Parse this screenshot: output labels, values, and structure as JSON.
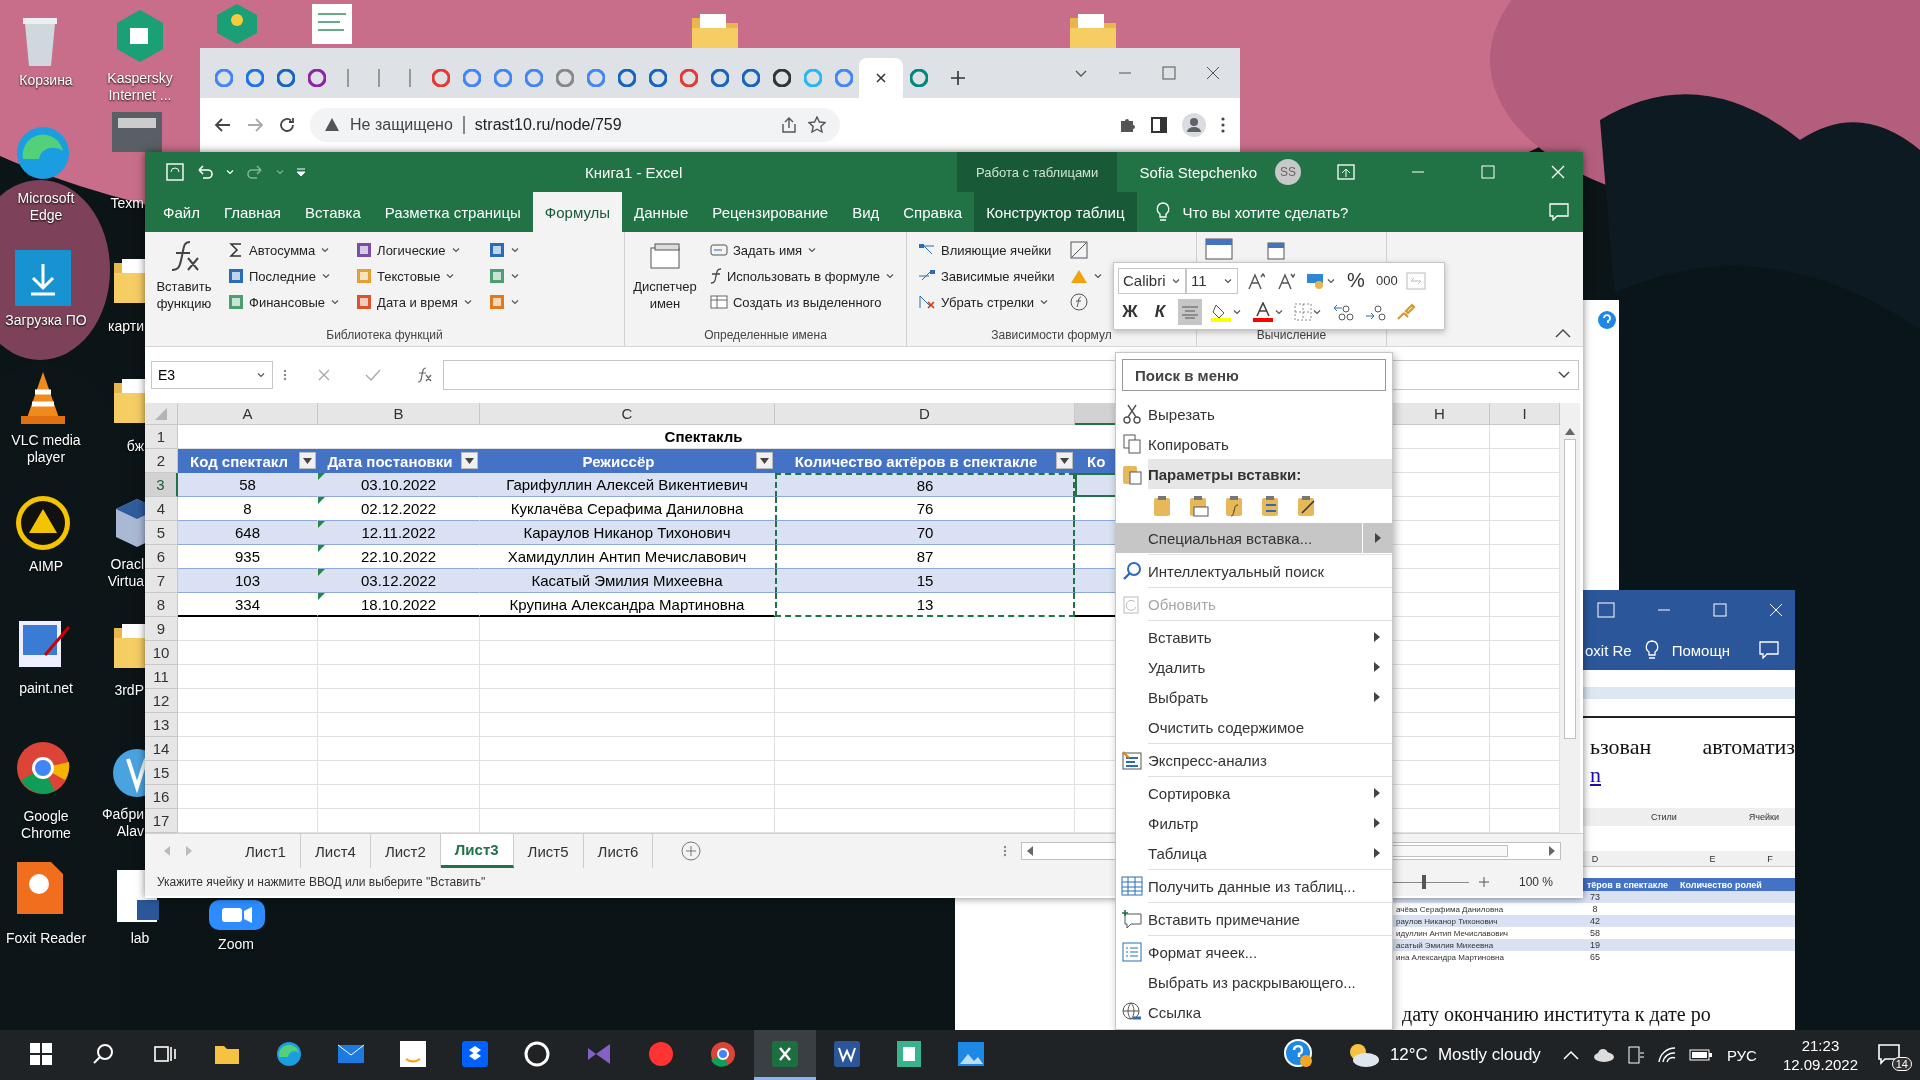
{
  "desktop_icons": [
    {
      "label": "Корзина"
    },
    {
      "label": "Microsoft Edge"
    },
    {
      "label": "Загрузка ПО"
    },
    {
      "label": "VLC media player"
    },
    {
      "label": "AIMP"
    },
    {
      "label": "paint.net"
    },
    {
      "label": "Google Chrome"
    },
    {
      "label": "Foxit Reader"
    },
    {
      "label": "Kaspersky Internet ..."
    },
    {
      "label": "Texm"
    },
    {
      "label": "карти"
    },
    {
      "label": "бж"
    },
    {
      "label": "Oracl Virtua"
    },
    {
      "label": "3rdP"
    },
    {
      "label": "Фабри Alav"
    },
    {
      "label": "lab"
    },
    {
      "label": "Zoom"
    }
  ],
  "browser": {
    "tabs": [
      {
        "selected": false
      },
      {
        "selected": false
      },
      {
        "selected": false
      },
      {
        "selected": false
      },
      {
        "selected": false
      },
      {
        "selected": false
      },
      {
        "selected": false
      },
      {
        "selected": false
      },
      {
        "selected": false
      },
      {
        "selected": false
      },
      {
        "selected": false
      },
      {
        "selected": false
      },
      {
        "selected": false
      },
      {
        "selected": false
      },
      {
        "selected": false
      },
      {
        "selected": false
      },
      {
        "selected": false
      },
      {
        "selected": false
      },
      {
        "selected": false
      },
      {
        "selected": false
      },
      {
        "selected": false
      },
      {
        "selected": true
      },
      {
        "selected": false
      }
    ],
    "security": "Не защищено",
    "url": "strast10.ru/node/759"
  },
  "excel": {
    "title": "Книга1 - Excel",
    "context_label": "Работа с таблицами",
    "user": "Sofia Stepchenko",
    "avatar": "SS",
    "tabs": [
      {
        "label": "Файл",
        "selected": false,
        "kind": "normal"
      },
      {
        "label": "Главная",
        "selected": false,
        "kind": "normal"
      },
      {
        "label": "Вставка",
        "selected": false,
        "kind": "normal"
      },
      {
        "label": "Разметка страницы",
        "selected": false,
        "kind": "normal"
      },
      {
        "label": "Формулы",
        "selected": true,
        "kind": "normal"
      },
      {
        "label": "Данные",
        "selected": false,
        "kind": "normal"
      },
      {
        "label": "Рецензирование",
        "selected": false,
        "kind": "normal"
      },
      {
        "label": "Вид",
        "selected": false,
        "kind": "normal"
      },
      {
        "label": "Справка",
        "selected": false,
        "kind": "normal"
      },
      {
        "label": "Конструктор таблиц",
        "selected": false,
        "kind": "contextual"
      }
    ],
    "tell_me": "Что вы хотите сделать?",
    "ribbon": [
      {
        "label": "Библиотека функций",
        "large_button": "Вставить функцию",
        "items": [
          {
            "label": "Автосумма",
            "dropdown": true
          },
          {
            "label": "Последние",
            "dropdown": true
          },
          {
            "label": "Финансовые",
            "dropdown": true
          },
          {
            "label": "Логические",
            "dropdown": true
          },
          {
            "label": "Текстовые",
            "dropdown": true
          },
          {
            "label": "Дата и время",
            "dropdown": true
          }
        ]
      },
      {
        "label": "Определенные имена",
        "large_button": "Диспетчер имен",
        "items": [
          {
            "label": "Задать имя",
            "dropdown": true
          },
          {
            "label": "Использовать в формуле",
            "dropdown": true
          },
          {
            "label": "Создать из выделенного",
            "dropdown": false
          }
        ]
      },
      {
        "label": "Зависимости формул",
        "items": [
          {
            "label": "Влияющие ячейки",
            "dropdown": false
          },
          {
            "label": "Зависимые ячейки",
            "dropdown": false
          },
          {
            "label": "Убрать стрелки",
            "dropdown": true
          }
        ]
      },
      {
        "label": "Вычисление"
      }
    ],
    "mini_toolbar": {
      "font": "Calibri",
      "size": "11",
      "percent": "%",
      "thousands": "000",
      "bold": "Ж",
      "italic": "К"
    },
    "name_box": "E3",
    "sheet": {
      "columns": [
        {
          "letter": "A",
          "selected": false
        },
        {
          "letter": "B",
          "selected": false,
          "flagged": true
        },
        {
          "letter": "C",
          "selected": false
        },
        {
          "letter": "D",
          "selected": false,
          "copied": true
        },
        {
          "selected": true
        },
        {
          "letter": "H",
          "selected": false
        },
        {
          "letter": "I",
          "selected": false
        }
      ],
      "row_numbers": [
        {
          "label": "1",
          "selected": false
        },
        {
          "label": "2",
          "selected": false
        },
        {
          "label": "3",
          "selected": true
        },
        {
          "label": "4",
          "selected": false
        },
        {
          "label": "5",
          "selected": false
        },
        {
          "label": "6",
          "selected": false
        },
        {
          "label": "7",
          "selected": false
        },
        {
          "label": "8",
          "selected": false
        },
        {
          "label": "9",
          "selected": false
        },
        {
          "label": "10",
          "selected": false
        },
        {
          "label": "11",
          "selected": false
        },
        {
          "label": "12",
          "selected": false
        },
        {
          "label": "13",
          "selected": false
        },
        {
          "label": "14",
          "selected": false
        },
        {
          "label": "15",
          "selected": false
        },
        {
          "label": "16",
          "selected": false
        },
        {
          "label": "17",
          "selected": false
        }
      ],
      "title": "Спектакль",
      "headers": [
        "Код спектакл",
        "Дата постановки",
        "Режиссёр",
        "Количество актёров в спектакле",
        "Ко"
      ],
      "rows": [
        [
          "58",
          "03.10.2022",
          "Гарифуллин Алексей Викентиевич",
          "86"
        ],
        [
          "8",
          "02.12.2022",
          "Куклачёва Серафима Даниловна",
          "76"
        ],
        [
          "648",
          "12.11.2022",
          "Караулов Никанор Тихонович",
          "70"
        ],
        [
          "935",
          "22.10.2022",
          "Хамидуллин Антип Мечиславович",
          "87"
        ],
        [
          "103",
          "03.12.2022",
          "Касатый Эмилия Михеевна",
          "15"
        ],
        [
          "334",
          "18.10.2022",
          "Крупина Александра Мартиновна",
          "13"
        ]
      ]
    },
    "sheet_tabs": [
      {
        "label": "Лист1",
        "selected": false
      },
      {
        "label": "Лист4",
        "selected": false
      },
      {
        "label": "Лист2",
        "selected": false
      },
      {
        "label": "Лист3",
        "selected": true
      },
      {
        "label": "Лист5",
        "selected": false
      },
      {
        "label": "Лист6",
        "selected": false
      }
    ],
    "status": "Укажите ячейку и нажмите ВВОД или выберите \"Вставить\"",
    "zoom": "100 %",
    "zoom_slider": {
      "level": 0.5
    }
  },
  "context_menu": [
    {
      "kind": "search",
      "placeholder": "Поиск в меню"
    },
    {
      "kind": "item",
      "label": "Вырезать",
      "selected": false,
      "disabled": false,
      "submenu": false
    },
    {
      "kind": "item",
      "label": "Копировать",
      "selected": false,
      "disabled": false,
      "submenu": false
    },
    {
      "kind": "header",
      "label": "Параметры вставки:"
    },
    {
      "kind": "paste-icons"
    },
    {
      "kind": "item",
      "label": "Специальная вставка...",
      "selected": true,
      "disabled": false,
      "submenu": true
    },
    {
      "kind": "separator"
    },
    {
      "kind": "item",
      "label": "Интеллектуальный поиск",
      "selected": false,
      "disabled": false,
      "submenu": false
    },
    {
      "kind": "separator"
    },
    {
      "kind": "item",
      "label": "Обновить",
      "selected": false,
      "disabled": true,
      "submenu": false
    },
    {
      "kind": "separator"
    },
    {
      "kind": "item",
      "label": "Вставить",
      "selected": false,
      "disabled": false,
      "submenu": true
    },
    {
      "kind": "item",
      "label": "Удалить",
      "selected": false,
      "disabled": false,
      "submenu": true
    },
    {
      "kind": "item",
      "label": "Выбрать",
      "selected": false,
      "disabled": false,
      "submenu": true
    },
    {
      "kind": "item",
      "label": "Очистить содержимое",
      "selected": false,
      "disabled": false,
      "submenu": false
    },
    {
      "kind": "separator"
    },
    {
      "kind": "item",
      "label": "Экспресс-анализ",
      "selected": false,
      "disabled": false,
      "submenu": false
    },
    {
      "kind": "separator"
    },
    {
      "kind": "item",
      "label": "Сортировка",
      "selected": false,
      "disabled": false,
      "submenu": true
    },
    {
      "kind": "item",
      "label": "Фильтр",
      "selected": false,
      "disabled": false,
      "submenu": true
    },
    {
      "kind": "item",
      "label": "Таблица",
      "selected": false,
      "disabled": false,
      "submenu": true
    },
    {
      "kind": "separator"
    },
    {
      "kind": "item",
      "label": "Получить данные из таблиц...",
      "selected": false,
      "disabled": false,
      "submenu": false
    },
    {
      "kind": "separator"
    },
    {
      "kind": "item",
      "label": "Вставить примечание",
      "selected": false,
      "disabled": false,
      "submenu": false
    },
    {
      "kind": "separator"
    },
    {
      "kind": "item",
      "label": "Формат ячеек...",
      "selected": false,
      "disabled": false,
      "submenu": false
    },
    {
      "kind": "item",
      "label": "Выбрать из раскрывающего...",
      "selected": false,
      "disabled": false,
      "submenu": false
    },
    {
      "kind": "item",
      "label": "Ссылка",
      "selected": false,
      "disabled": false,
      "submenu": false
    }
  ],
  "word_window": {
    "tab": "oxit Re",
    "help": "Помощн",
    "words": [
      "ьзован",
      "автоматиз"
    ],
    "link": "n",
    "image": {
      "ribbon_labels": [
        "Стили",
        "Ячейки"
      ],
      "columns": [
        "D",
        "E",
        "F"
      ],
      "headers": [
        "тёров в спектакле",
        "Количество ролей"
      ],
      "rows": [
        {
          "value": "73"
        },
        {
          "name": "ачёва Серафима Даниловна",
          "value": "8"
        },
        {
          "name": "раулов Никанор Тихонович",
          "value": "42"
        },
        {
          "name": "идуллин Антип Мечиславович",
          "value": "58"
        },
        {
          "name": "асатый Эмилия Михеевна",
          "value": "19"
        },
        {
          "name": "ина Александра Мартиновна",
          "value": "65"
        }
      ]
    },
    "bottom_text": "дату окончанию института к дате ро"
  },
  "taskbar": {
    "apps": [
      {
        "selected": false
      },
      {
        "selected": false
      },
      {
        "selected": false
      },
      {
        "selected": false
      },
      {
        "selected": false
      },
      {
        "selected": false
      },
      {
        "selected": false
      },
      {
        "selected": false
      },
      {
        "selected": false
      },
      {
        "selected": true
      },
      {
        "selected": false
      },
      {
        "selected": false
      },
      {
        "selected": false
      }
    ],
    "temperature": "12°C",
    "weather": "Mostly cloudy",
    "language": "РУС",
    "time": "21:23",
    "date": "12.09.2022",
    "notifications": "14"
  }
}
